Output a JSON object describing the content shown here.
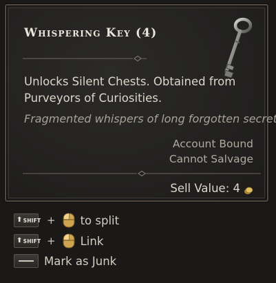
{
  "item": {
    "title": "Whispering Key (4)",
    "description": "Unlocks Silent Chests. Obtained from Purveyors of Curiosities.",
    "flavor": "Fragmented whispers of long forgotten secrets.",
    "tags": [
      "Account Bound",
      "Cannot Salvage"
    ],
    "sell_label": "Sell Value: 4",
    "icon": "skeleton-key-icon"
  },
  "actions": [
    {
      "key": "SHIFT",
      "key_icon": "shift-key-icon",
      "mouse_icon": "mouse-click-icon",
      "label": "to split"
    },
    {
      "key": "SHIFT",
      "key_icon": "shift-key-icon",
      "mouse_icon": "mouse-click-icon",
      "label": "Link"
    },
    {
      "key_icon": "spacebar-key-icon",
      "label": "Mark as Junk"
    }
  ],
  "separator": "+",
  "colors": {
    "panel_bg": "#252422",
    "border": "#514b43",
    "title": "#ece6dc",
    "body_text": "#ddd6cb",
    "flavor_text": "#a9a196",
    "gold": "#c9a54a"
  }
}
